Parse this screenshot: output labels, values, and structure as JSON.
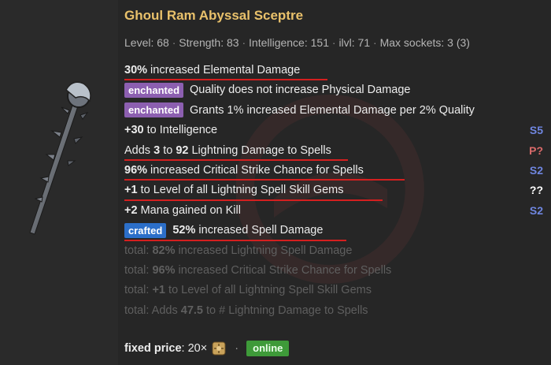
{
  "item": {
    "name": "Ghoul Ram Abyssal Sceptre",
    "requirements": [
      "Level: 68",
      "Strength: 83",
      "Intelligence: 151",
      "ilvl: 71",
      "Max sockets: 3 (3)"
    ],
    "separator": "·"
  },
  "mods": [
    {
      "prefix": "",
      "value": "30%",
      "text": " increased Elemental Damage",
      "tier": "",
      "underline": true
    },
    {
      "badge": "enchanted",
      "text": "Quality does not increase Physical Damage",
      "tier": ""
    },
    {
      "badge": "enchanted",
      "text": "Grants 1% increased Elemental Damage per 2% Quality",
      "tier": ""
    },
    {
      "prefix": "",
      "value": "+30",
      "text": " to Intelligence",
      "tier": "S5",
      "tier_color": "#6f86e0",
      "underline": false
    },
    {
      "prefix": "Adds ",
      "value": "3",
      "mid": " to ",
      "value2": "92",
      "text": " Lightning Damage to Spells",
      "tier": "P?",
      "tier_color": "#d96a6a",
      "underline": true
    },
    {
      "prefix": "",
      "value": "96%",
      "text": " increased Critical Strike Chance for Spells",
      "tier": "S2",
      "tier_color": "#6f86e0",
      "underline": true
    },
    {
      "prefix": "",
      "value": "+1",
      "text": " to Level of all Lightning Spell Skill Gems",
      "tier": "??",
      "tier_color": "#ffffff",
      "underline": true
    },
    {
      "prefix": "",
      "value": "+2",
      "text": " Mana gained on Kill",
      "tier": "S2",
      "tier_color": "#6f86e0",
      "underline": false
    },
    {
      "badge": "crafted",
      "value": "52%",
      "text": " increased Spell Damage",
      "tier": "",
      "underline": true
    }
  ],
  "totals": [
    {
      "prefix": "total: ",
      "value": "82%",
      "text": " increased Lightning Spell Damage"
    },
    {
      "prefix": "total: ",
      "value": "96%",
      "text": " increased Critical Strike Chance for Spells"
    },
    {
      "prefix": "total: ",
      "value": "+1",
      "text": " to Level of all Lightning Spell Skill Gems"
    },
    {
      "prefix": "total: Adds ",
      "value": "47.5",
      "text": " to # Lightning Damage to Spells"
    }
  ],
  "listing": {
    "price_label": "fixed price",
    "price_value": ": 20×",
    "currency_icon": "exalted-orb-icon",
    "dot": "·",
    "status": "online"
  },
  "colors": {
    "title": "#e9c16b",
    "underline": "#d51f1f",
    "enchanted": "#8c5fb0",
    "crafted": "#2c6fc9",
    "online": "#3e9a39"
  }
}
